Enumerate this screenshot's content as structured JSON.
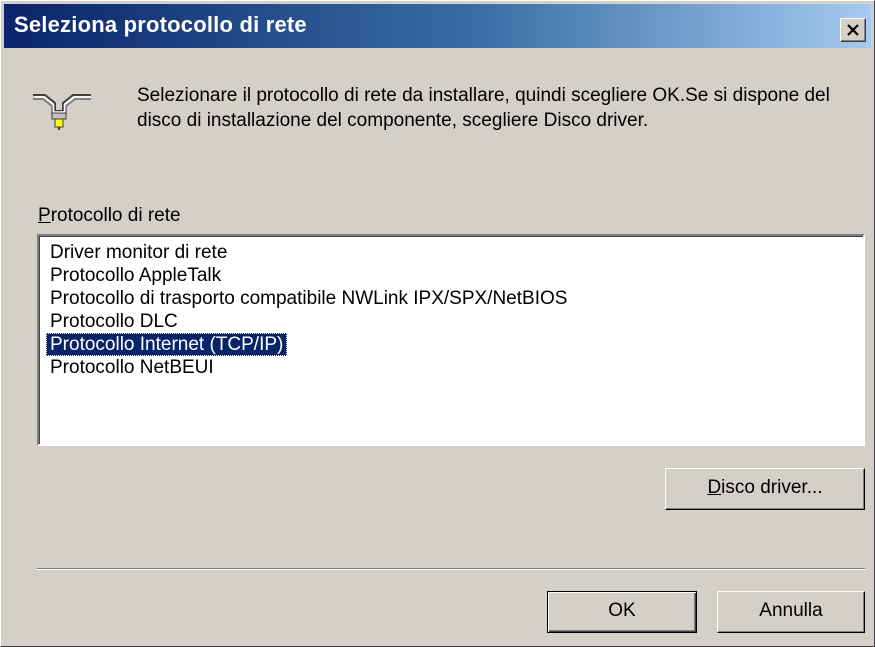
{
  "window": {
    "title": "Seleziona protocollo di rete",
    "close_glyph": "✕"
  },
  "header": {
    "icon": "network-protocol-icon",
    "instructions": "Selezionare il protocollo di rete da installare, quindi scegliere OK.Se si dispone del disco di installazione del componente, scegliere Disco driver."
  },
  "protocol_list": {
    "label_accel": "P",
    "label_rest": "rotocollo di rete",
    "items": [
      {
        "label": "Driver monitor di rete"
      },
      {
        "label": "Protocollo AppleTalk"
      },
      {
        "label": "Protocollo di trasporto compatibile NWLink IPX/SPX/NetBIOS"
      },
      {
        "label": "Protocollo DLC"
      },
      {
        "label": "Protocollo Internet (TCP/IP)"
      },
      {
        "label": "Protocollo NetBEUI"
      }
    ],
    "selected": "Protocollo Internet (TCP/IP)"
  },
  "buttons": {
    "disk_accel": "D",
    "disk_rest": "isco driver...",
    "ok": "OK",
    "cancel": "Annulla"
  },
  "colors": {
    "title_bar_start": "#0a246a",
    "title_bar_end": "#a6caf0",
    "dialog_face": "#d4d0c8",
    "selection": "#0a246a"
  }
}
